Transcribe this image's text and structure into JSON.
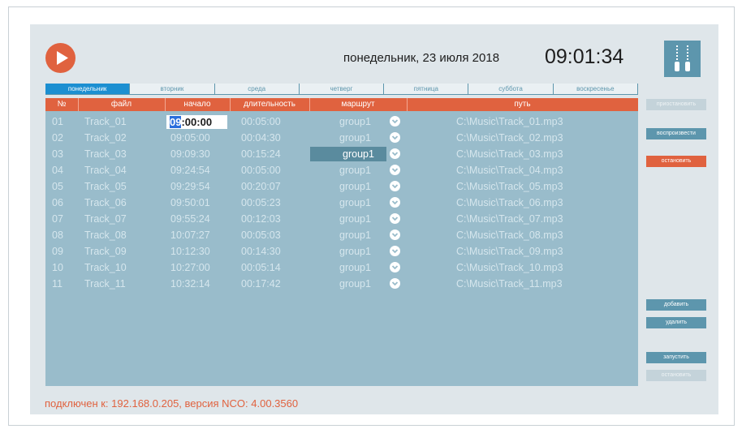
{
  "header": {
    "date": "понедельник, 23 июля 2018",
    "time": "09:01:34",
    "play_icon": "play-icon",
    "logo_icon": "audio-cables-logo"
  },
  "tabs": [
    {
      "label": "понедельник",
      "active": true
    },
    {
      "label": "вторник",
      "active": false
    },
    {
      "label": "среда",
      "active": false
    },
    {
      "label": "четверг",
      "active": false
    },
    {
      "label": "пятница",
      "active": false
    },
    {
      "label": "суббота",
      "active": false
    },
    {
      "label": "воскресенье",
      "active": false
    }
  ],
  "table": {
    "columns": {
      "num": "№",
      "file": "файл",
      "start": "начало",
      "duration": "длительность",
      "route": "маршрут",
      "path": "путь"
    },
    "rows": [
      {
        "num": "01",
        "file": "Track_01",
        "start": "09:00:00",
        "start_sel": "09",
        "start_rest": ":00:00",
        "duration": "00:05:00",
        "route": "group1",
        "path": "C:\\Music\\Track_01.mp3"
      },
      {
        "num": "02",
        "file": "Track_02",
        "start": "09:05:00",
        "duration": "00:04:30",
        "route": "group1",
        "path": "C:\\Music\\Track_02.mp3"
      },
      {
        "num": "03",
        "file": "Track_03",
        "start": "09:09:30",
        "duration": "00:15:24",
        "route": "group1",
        "path": "C:\\Music\\Track_03.mp3"
      },
      {
        "num": "04",
        "file": "Track_04",
        "start": "09:24:54",
        "duration": "00:05:00",
        "route": "group1",
        "path": "C:\\Music\\Track_04.mp3"
      },
      {
        "num": "05",
        "file": "Track_05",
        "start": "09:29:54",
        "duration": "00:20:07",
        "route": "group1",
        "path": "C:\\Music\\Track_05.mp3"
      },
      {
        "num": "06",
        "file": "Track_06",
        "start": "09:50:01",
        "duration": "00:05:23",
        "route": "group1",
        "path": "C:\\Music\\Track_06.mp3"
      },
      {
        "num": "07",
        "file": "Track_07",
        "start": "09:55:24",
        "duration": "00:12:03",
        "route": "group1",
        "path": "C:\\Music\\Track_07.mp3"
      },
      {
        "num": "08",
        "file": "Track_08",
        "start": "10:07:27",
        "duration": "00:05:03",
        "route": "group1",
        "path": "C:\\Music\\Track_08.mp3"
      },
      {
        "num": "09",
        "file": "Track_09",
        "start": "10:12:30",
        "duration": "00:14:30",
        "route": "group1",
        "path": "C:\\Music\\Track_09.mp3"
      },
      {
        "num": "10",
        "file": "Track_10",
        "start": "10:27:00",
        "duration": "00:05:14",
        "route": "group1",
        "path": "C:\\Music\\Track_10.mp3"
      },
      {
        "num": "11",
        "file": "Track_11",
        "start": "10:32:14",
        "duration": "00:17:42",
        "route": "group1",
        "path": "C:\\Music\\Track_11.mp3"
      }
    ]
  },
  "sidebar": {
    "btn1": "приостановить",
    "btn2": "воспроизвести",
    "btn3": "остановить",
    "add": "добавить",
    "delete": "удалить",
    "run": "запустить",
    "stop_run": "остановить"
  },
  "status": "подключен к: 192.168.0.205, версия NCO: 4.00.3560",
  "colors": {
    "accent_red": "#e0623f",
    "accent_teal": "#5d96ad",
    "tab_active": "#1c8fd1",
    "table_bg": "#99bccb"
  }
}
